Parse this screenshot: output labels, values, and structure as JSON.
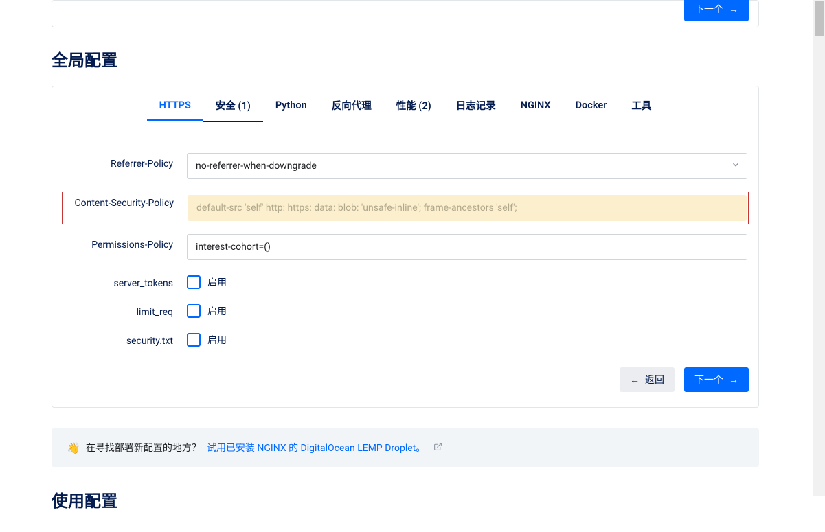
{
  "topCard": {
    "nextLabel": "下一个"
  },
  "sectionTitle": "全局配置",
  "tabs": [
    {
      "label": "HTTPS"
    },
    {
      "label": "安全 (1)"
    },
    {
      "label": "Python"
    },
    {
      "label": "反向代理"
    },
    {
      "label": "性能 (2)"
    },
    {
      "label": "日志记录"
    },
    {
      "label": "NGINX"
    },
    {
      "label": "Docker"
    },
    {
      "label": "工具"
    }
  ],
  "form": {
    "referrerPolicy": {
      "label": "Referrer-Policy",
      "value": "no-referrer-when-downgrade"
    },
    "csp": {
      "label": "Content-Security-Policy",
      "placeholder": "default-src 'self' http: https: data: blob: 'unsafe-inline'; frame-ancestors 'self';"
    },
    "permissionsPolicy": {
      "label": "Permissions-Policy",
      "value": "interest-cohort=()"
    },
    "serverTokens": {
      "label": "server_tokens",
      "enable": "启用"
    },
    "limitReq": {
      "label": "limit_req",
      "enable": "启用"
    },
    "securityTxt": {
      "label": "security.txt",
      "enable": "启用"
    }
  },
  "footer": {
    "backLabel": "返回",
    "nextLabel": "下一个"
  },
  "promo": {
    "emoji": "👋",
    "textBefore": "在寻找部署新配置的地方？",
    "linkText": "试用已安装 NGINX 的 DigitalOcean LEMP Droplet。"
  },
  "usageTitle": "使用配置"
}
